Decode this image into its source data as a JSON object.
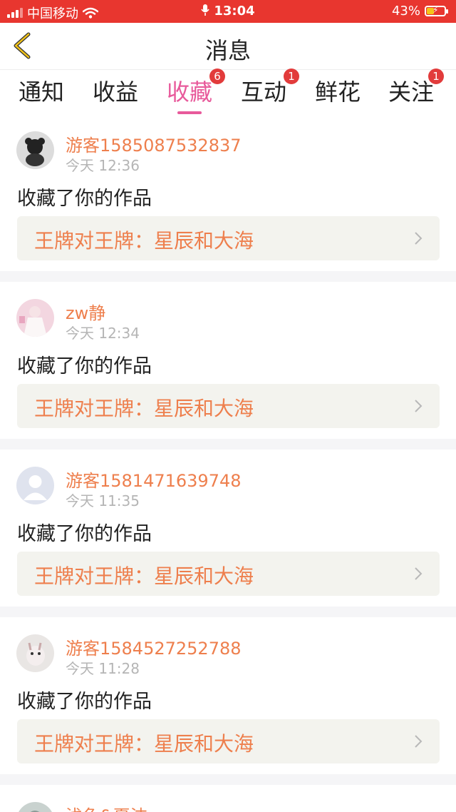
{
  "status": {
    "carrier": "中国移动",
    "time": "13:04",
    "battery": "43%",
    "battery_level": 0.43
  },
  "header": {
    "title": "消息"
  },
  "tabs": [
    {
      "label": "通知",
      "badge": ""
    },
    {
      "label": "收益",
      "badge": ""
    },
    {
      "label": "收藏",
      "badge": "6",
      "active": true
    },
    {
      "label": "互动",
      "badge": "1"
    },
    {
      "label": "鲜花",
      "badge": ""
    },
    {
      "label": "关注",
      "badge": "1"
    }
  ],
  "messages": [
    {
      "name": "游客1585087532837",
      "time": "今天 12:36",
      "action": "收藏了你的作品",
      "work": "王牌对王牌：星辰和大海"
    },
    {
      "name": "zw静",
      "time": "今天 12:34",
      "action": "收藏了你的作品",
      "work": "王牌对王牌：星辰和大海"
    },
    {
      "name": "游客1581471639748",
      "time": "今天 11:35",
      "action": "收藏了你的作品",
      "work": "王牌对王牌：星辰和大海"
    },
    {
      "name": "游客1584527252788",
      "time": "今天 11:28",
      "action": "收藏了你的作品",
      "work": "王牌对王牌：星辰和大海"
    }
  ],
  "peek": {
    "name": "浅兔&夏沫"
  },
  "colors": {
    "statusbar": "#e8362f",
    "accent_tab": "#e85a9b",
    "name_orange": "#ee7f4d",
    "badge_red": "#e23b3b"
  }
}
